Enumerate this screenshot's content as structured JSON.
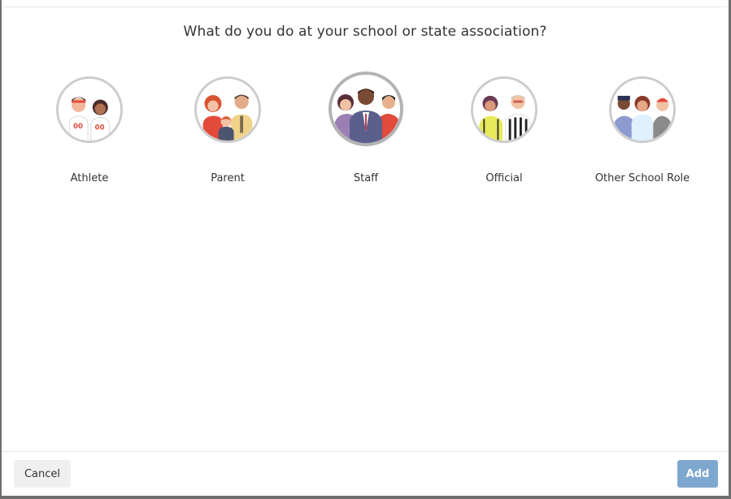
{
  "dialog": {
    "question": "What do you do at your school or state association?"
  },
  "roles": [
    {
      "label": "Athlete",
      "icon": "athletes-illustration-icon",
      "selected": false
    },
    {
      "label": "Parent",
      "icon": "parents-illustration-icon",
      "selected": false
    },
    {
      "label": "Staff",
      "icon": "staff-illustration-icon",
      "selected": true
    },
    {
      "label": "Official",
      "icon": "officials-illustration-icon",
      "selected": false
    },
    {
      "label": "Other School Role",
      "icon": "other-role-illustration-icon",
      "selected": false
    }
  ],
  "footer": {
    "cancel_label": "Cancel",
    "add_label": "Add"
  },
  "colors": {
    "add_button": "#7ea7d0",
    "avatar_border": "#cccccc",
    "selected_border": "#b3b3b3"
  }
}
